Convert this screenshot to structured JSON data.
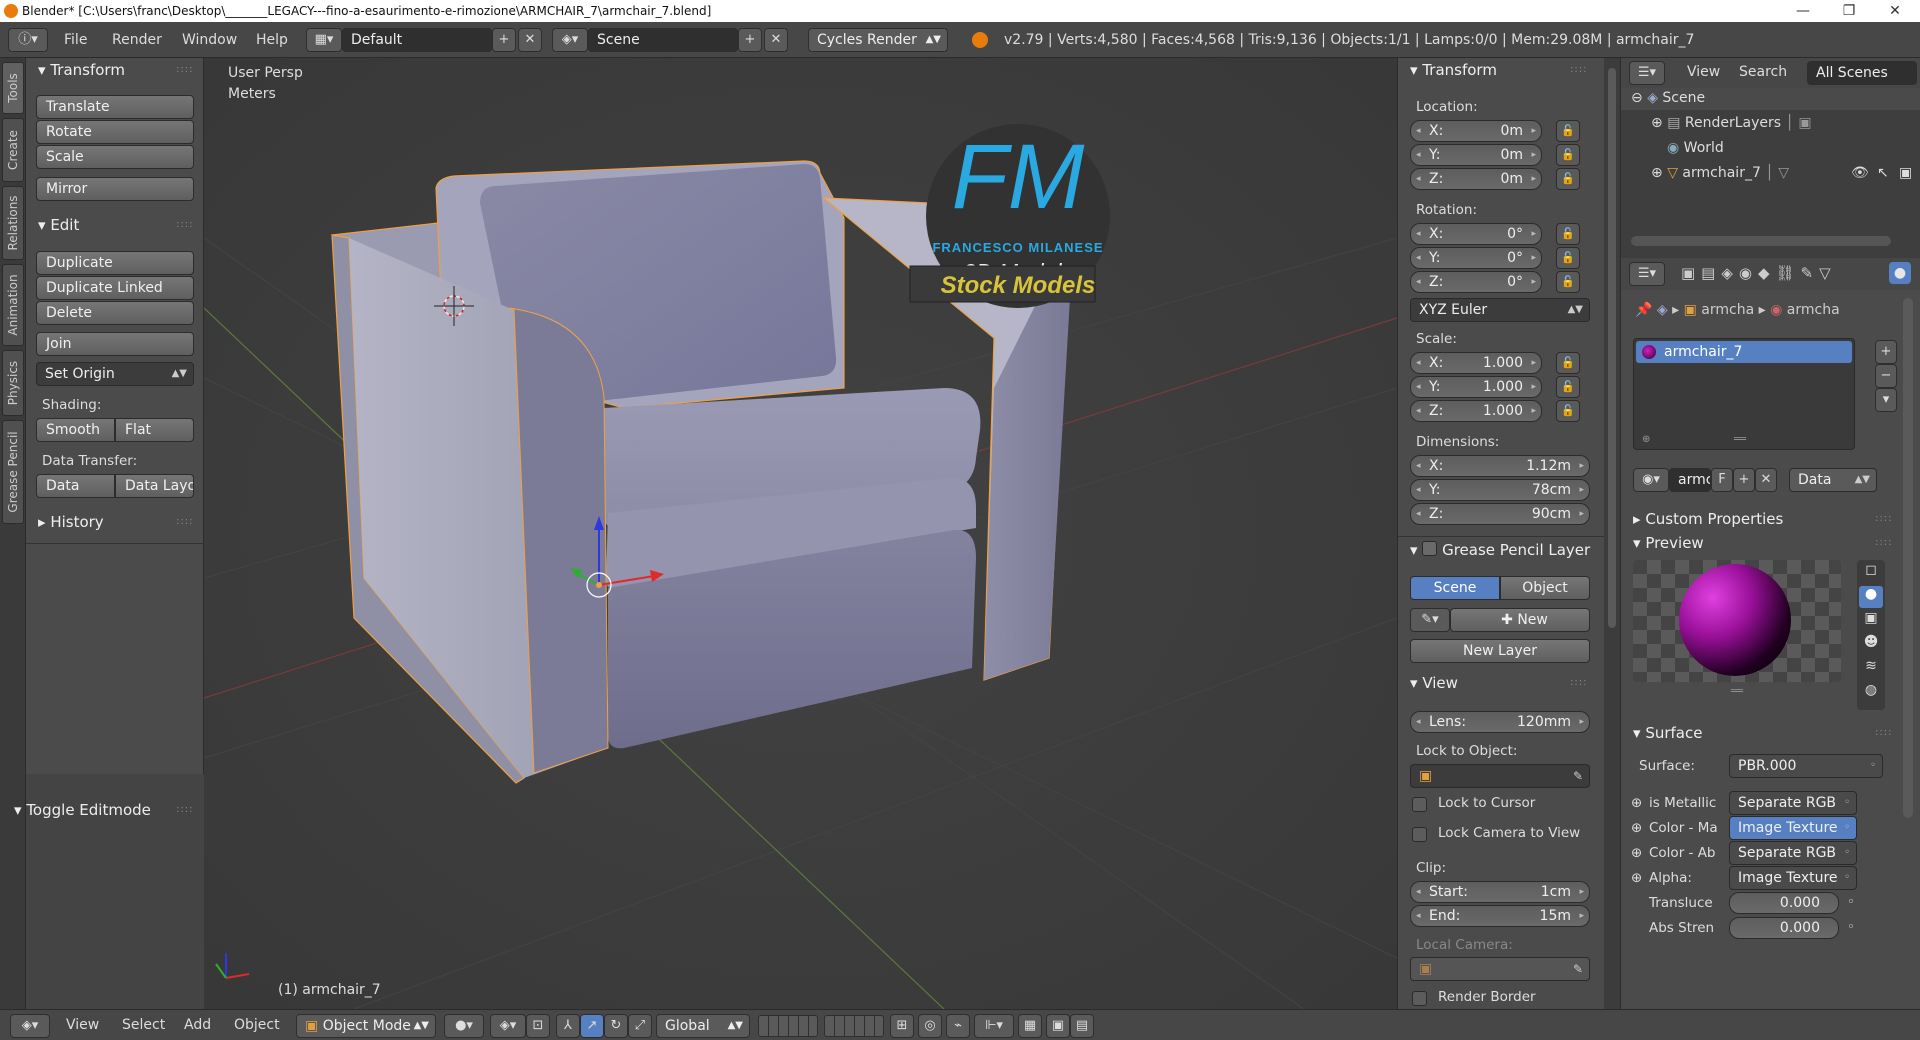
{
  "window": {
    "title": "Blender* [C:\\Users\\franc\\Desktop\\_______LEGACY---fino-a-esaurimento-e-rimozione\\ARMCHAIR_7\\armchair_7.blend]",
    "minimize": "—",
    "maximize": "❐",
    "close": "✕"
  },
  "topbar": {
    "menus": [
      "File",
      "Render",
      "Window",
      "Help"
    ],
    "layout": "Default",
    "scene": "Scene",
    "engine": "Cycles Render",
    "stats": "v2.79 | Verts:4,580 | Faces:4,568 | Tris:9,136 | Objects:1/1 | Lamps:0/0 | Mem:29.08M | armchair_7"
  },
  "tool_tabs": [
    "Tools",
    "Create",
    "Relations",
    "Animation",
    "Physics",
    "Grease Pencil"
  ],
  "tools": {
    "transform_header": "Transform",
    "translate": "Translate",
    "rotate": "Rotate",
    "scale": "Scale",
    "mirror": "Mirror",
    "edit_header": "Edit",
    "duplicate": "Duplicate",
    "duplicate_linked": "Duplicate Linked",
    "delete": "Delete",
    "join": "Join",
    "set_origin": "Set Origin",
    "shading_label": "Shading:",
    "smooth": "Smooth",
    "flat": "Flat",
    "data_transfer_label": "Data Transfer:",
    "data": "Data",
    "data_layout": "Data Layo",
    "history_header": "History",
    "toggle_editmode": "Toggle Editmode"
  },
  "viewport": {
    "view_name": "User Persp",
    "units": "Meters",
    "object_label": "(1) armchair_7",
    "logo_initials": "FM",
    "logo_name": "FRANCESCO MILANESE",
    "logo_sub": "3D Models",
    "logo_banner": "Stock Models"
  },
  "properties_n": {
    "transform_header": "Transform",
    "location_label": "Location:",
    "loc_x": "X:",
    "loc_x_val": "0m",
    "loc_y": "Y:",
    "loc_y_val": "0m",
    "loc_z": "Z:",
    "loc_z_val": "0m",
    "rotation_label": "Rotation:",
    "rot_x": "X:",
    "rot_x_val": "0°",
    "rot_y": "Y:",
    "rot_y_val": "0°",
    "rot_z": "Z:",
    "rot_z_val": "0°",
    "rotation_mode": "XYZ Euler",
    "scale_label": "Scale:",
    "sc_x": "X:",
    "sc_x_val": "1.000",
    "sc_y": "Y:",
    "sc_y_val": "1.000",
    "sc_z": "Z:",
    "sc_z_val": "1.000",
    "dimensions_label": "Dimensions:",
    "dim_x": "X:",
    "dim_x_val": "1.12m",
    "dim_y": "Y:",
    "dim_y_val": "78cm",
    "dim_z": "Z:",
    "dim_z_val": "90cm",
    "grease_header": "Grease Pencil Layer",
    "gp_scene": "Scene",
    "gp_object": "Object",
    "gp_new": "New",
    "gp_new_layer": "New Layer",
    "view_header": "View",
    "lens_label": "Lens:",
    "lens_val": "120mm",
    "lock_to_object": "Lock to Object:",
    "lock_to_cursor": "Lock to Cursor",
    "lock_camera": "Lock Camera to View",
    "clip_label": "Clip:",
    "clip_start": "Start:",
    "clip_start_val": "1cm",
    "clip_end": "End:",
    "clip_end_val": "15m",
    "local_camera": "Local Camera:",
    "render_border": "Render Border"
  },
  "outliner": {
    "view": "View",
    "search": "Search",
    "filter": "All Scenes",
    "items": [
      "Scene",
      "RenderLayers",
      "World",
      "armchair_7"
    ]
  },
  "material": {
    "crumb_1": "armcha",
    "crumb_2": "armcha",
    "slot_name": "armchair_7",
    "mat_short": "armc",
    "fake_user": "F",
    "link_mode": "Data",
    "custom_props": "Custom Properties",
    "preview": "Preview",
    "surface_header": "Surface",
    "surface_label": "Surface:",
    "surface_val": "PBR.000",
    "rows": [
      {
        "label": "is Metallic",
        "value": "Separate RGB"
      },
      {
        "label": "Color - Ma",
        "value": "Image Texture"
      },
      {
        "label": "Color - Ab",
        "value": "Separate RGB"
      },
      {
        "label": "Alpha:",
        "value": "Image Texture"
      }
    ],
    "translucency_label": "Transluce",
    "translucency_val": "0.000",
    "abs_label": "Abs Stren",
    "abs_val": "0.000"
  },
  "bottombar": {
    "view": "View",
    "select": "Select",
    "add": "Add",
    "object": "Object",
    "mode": "Object Mode",
    "orientation": "Global"
  },
  "colors": {
    "accent": "#5680c2",
    "selection_outline": "#f0a040",
    "armchair": "#8f8fa8",
    "logo_blue": "#2aa8e0",
    "logo_yellow": "#d8c43a"
  }
}
